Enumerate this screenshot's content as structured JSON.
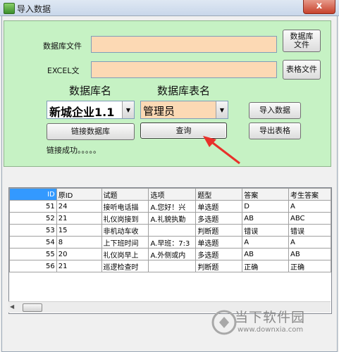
{
  "window": {
    "title": "导入数据",
    "close_label": "x"
  },
  "form": {
    "db_file_label": "数据库文件",
    "excel_label": "EXCEL文",
    "db_file_button": "数据库\n文件",
    "excel_button": "表格文件",
    "db_name_label": "数据库名",
    "table_name_label": "数据库表名",
    "db_name_value": "新城企业1.1",
    "table_name_value": "管理员",
    "import_button": "导入数据",
    "connect_button": "链接数据库",
    "query_button": "查询",
    "export_button": "导出表格",
    "status_text": "链接成功。。。。。"
  },
  "grid": {
    "columns": [
      "ID",
      "原ID",
      "试题",
      "选项",
      "题型",
      "答案",
      "考生答案"
    ],
    "rows": [
      [
        "51",
        "24",
        "接听电话描",
        "A.您好！兴",
        "单选题",
        "D",
        "A"
      ],
      [
        "52",
        "21",
        "礼仪岗接到",
        "A.礼貌执勤",
        "多选题",
        "AB",
        "ABC"
      ],
      [
        "53",
        "15",
        "非机动车收",
        "",
        "判断题",
        "错误",
        "错误"
      ],
      [
        "54",
        "8",
        "上下班时间",
        "A.早班：7:3",
        "单选题",
        "A",
        "A"
      ],
      [
        "55",
        "20",
        "礼仪岗早上",
        "A.外侧或内",
        "多选题",
        "AB",
        "AB"
      ],
      [
        "56",
        "21",
        "巡逻检查时",
        "",
        "判断题",
        "正确",
        "正确"
      ]
    ]
  },
  "watermark": {
    "text": "当下软件园",
    "url": "www.downxia.com"
  },
  "colors": {
    "panel": "#c6f2c4",
    "input": "#fcd9b4",
    "header_selected": "#3399ff",
    "annotation_arrow": "#e8302a"
  }
}
